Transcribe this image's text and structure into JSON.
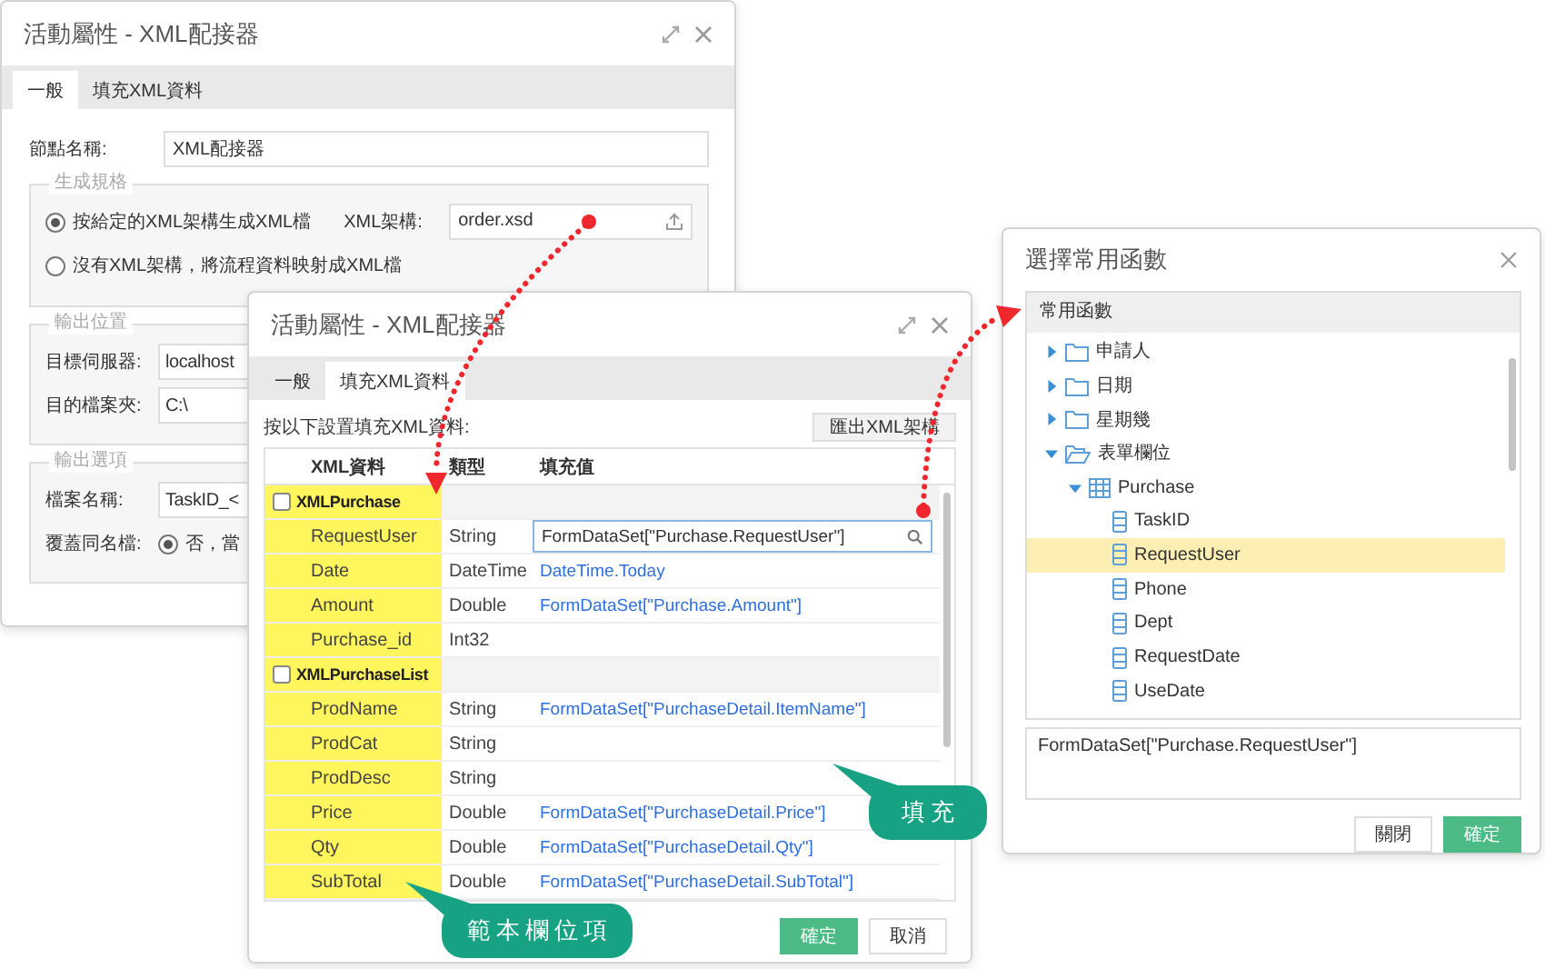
{
  "main_dialog": {
    "title": "活動屬性 - XML配接器",
    "tabs": [
      {
        "label": "一般",
        "selected": true
      },
      {
        "label": "填充XML資料",
        "selected": false
      }
    ],
    "node_name": {
      "label": "節點名稱:",
      "value": "XML配接器"
    },
    "schema_group": {
      "legend": "生成規格",
      "options": [
        {
          "label": "按給定的XML架構生成XML檔",
          "checked": true
        },
        {
          "label": "沒有XML架構，將流程資料映射成XML檔",
          "checked": false
        }
      ],
      "schema_field": {
        "label": "XML架構:",
        "value": "order.xsd"
      }
    },
    "output_location": {
      "legend": "輸出位置",
      "server": {
        "label": "目標伺服器:",
        "value": "localhost"
      },
      "folder": {
        "label": "目的檔案夾:",
        "value": "C:\\"
      }
    },
    "output_options": {
      "legend": "輸出選項",
      "file_name": {
        "label": "檔案名稱:",
        "value": "TaskID_<"
      },
      "overwrite": {
        "label": "覆蓋同名檔:",
        "option": {
          "label": "否，當",
          "checked": true
        }
      }
    }
  },
  "fill_dialog": {
    "title": "活動屬性 - XML配接器",
    "tabs": [
      {
        "label": "一般",
        "selected": false
      },
      {
        "label": "填充XML資料",
        "selected": true
      }
    ],
    "instruction": "按以下設置填充XML資料:",
    "export_button": "匯出XML架構",
    "columns": [
      "XML資料",
      "類型",
      "填充值"
    ],
    "rows": [
      {
        "kind": "group",
        "name": "XMLPurchase",
        "checked": false
      },
      {
        "kind": "field",
        "name": "RequestUser",
        "type": "String",
        "value": "FormDataSet[\"Purchase.RequestUser\"]",
        "editing": true
      },
      {
        "kind": "field",
        "name": "Date",
        "type": "DateTime",
        "value": "DateTime.Today",
        "editing": false
      },
      {
        "kind": "field",
        "name": "Amount",
        "type": "Double",
        "value": "FormDataSet[\"Purchase.Amount\"]",
        "editing": false
      },
      {
        "kind": "field",
        "name": "Purchase_id",
        "type": "Int32",
        "editing": false
      },
      {
        "kind": "group",
        "name": "XMLPurchaseList",
        "checked": false
      },
      {
        "kind": "field",
        "name": "ProdName",
        "type": "String",
        "value": "FormDataSet[\"PurchaseDetail.ItemName\"]",
        "editing": false
      },
      {
        "kind": "field",
        "name": "ProdCat",
        "type": "String",
        "editing": false
      },
      {
        "kind": "field",
        "name": "ProdDesc",
        "type": "String",
        "editing": false
      },
      {
        "kind": "field",
        "name": "Price",
        "type": "Double",
        "value": "FormDataSet[\"PurchaseDetail.Price\"]",
        "editing": false
      },
      {
        "kind": "field",
        "name": "Qty",
        "type": "Double",
        "value": "FormDataSet[\"PurchaseDetail.Qty\"]",
        "editing": false
      },
      {
        "kind": "field",
        "name": "SubTotal",
        "type": "Double",
        "value": "FormDataSet[\"PurchaseDetail.SubTotal\"]",
        "editing": false
      }
    ],
    "buttons": [
      {
        "label": "確定",
        "primary": true
      },
      {
        "label": "取消",
        "primary": false
      }
    ]
  },
  "function_dialog": {
    "title": "選擇常用函數",
    "tree": {
      "header": "常用函數",
      "items": [
        {
          "label": "申請人",
          "kind": "folder",
          "expanded": false,
          "selected": false
        },
        {
          "label": "日期",
          "kind": "folder",
          "expanded": false,
          "selected": false
        },
        {
          "label": "星期幾",
          "kind": "folder",
          "expanded": false,
          "selected": false
        },
        {
          "label": "表單欄位",
          "kind": "folder",
          "expanded": true,
          "selected": false,
          "children": [
            {
              "label": "Purchase",
              "kind": "table",
              "expanded": true,
              "selected": false,
              "children": [
                {
                  "label": "TaskID",
                  "kind": "field",
                  "selected": false
                },
                {
                  "label": "RequestUser",
                  "kind": "field",
                  "selected": true
                },
                {
                  "label": "Phone",
                  "kind": "field",
                  "selected": false
                },
                {
                  "label": "Dept",
                  "kind": "field",
                  "selected": false
                },
                {
                  "label": "RequestDate",
                  "kind": "field",
                  "selected": false
                },
                {
                  "label": "UseDate",
                  "kind": "field",
                  "selected": false
                }
              ]
            }
          ]
        }
      ]
    },
    "formula": "FormDataSet[\"Purchase.RequestUser\"]",
    "buttons": [
      {
        "label": "關閉",
        "primary": false
      },
      {
        "label": "確定",
        "primary": true
      }
    ]
  },
  "callouts": [
    {
      "text": "填充"
    },
    {
      "text": "範本欄位項"
    }
  ]
}
